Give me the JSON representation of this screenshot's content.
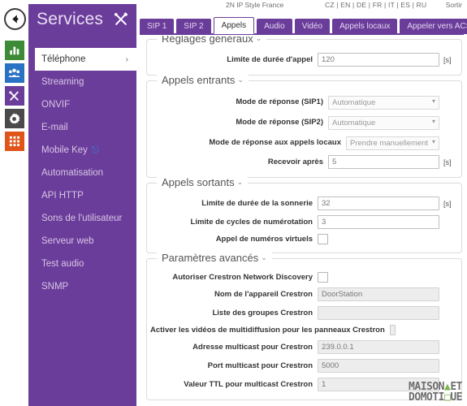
{
  "topbar": {
    "device_name": "2N IP Style France",
    "languages": [
      "CZ",
      "EN",
      "DE",
      "FR",
      "IT",
      "ES",
      "RU"
    ],
    "logout_label": "Sortir"
  },
  "header": {
    "title": "Services",
    "tools_icon": "tools-icon",
    "back_icon": "back-arrow-icon"
  },
  "icon_rail": [
    {
      "name": "status-dashboard-icon",
      "glyph": "bar-chart-icon",
      "color": "#3d8b37"
    },
    {
      "name": "directory-icon",
      "glyph": "people-icon",
      "color": "#2a72c4"
    },
    {
      "name": "services-icon",
      "glyph": "tools-icon",
      "color": "#6b3d9a"
    },
    {
      "name": "hardware-icon",
      "glyph": "gear-icon",
      "color": "#4a4a4a"
    },
    {
      "name": "system-icon",
      "glyph": "grid-icon",
      "color": "#e0541a"
    }
  ],
  "sidebar": {
    "items": [
      {
        "label": "Téléphone",
        "active": true,
        "chevron": "›"
      },
      {
        "label": "Streaming",
        "active": false
      },
      {
        "label": "ONVIF",
        "active": false
      },
      {
        "label": "E-mail",
        "active": false
      },
      {
        "label": "Mobile Key",
        "active": false,
        "badge_icon": "bluetooth-icon"
      },
      {
        "label": "Automatisation",
        "active": false
      },
      {
        "label": "API HTTP",
        "active": false
      },
      {
        "label": "Sons de l'utilisateur",
        "active": false
      },
      {
        "label": "Serveur web",
        "active": false
      },
      {
        "label": "Test audio",
        "active": false
      },
      {
        "label": "SNMP",
        "active": false
      }
    ]
  },
  "tabs": [
    {
      "label": "SIP 1",
      "active": false
    },
    {
      "label": "SIP 2",
      "active": false
    },
    {
      "label": "Appels",
      "active": true
    },
    {
      "label": "Audio",
      "active": false
    },
    {
      "label": "Vidéo",
      "active": false
    },
    {
      "label": "Appels locaux",
      "active": false
    },
    {
      "label": "Appeler vers ACS",
      "active": false
    }
  ],
  "sections": {
    "general": {
      "title": "Réglages généraux",
      "caret": "⌄",
      "call_duration_limit": {
        "label": "Limite de durée d'appel",
        "value": "120",
        "unit": "[s]"
      }
    },
    "incoming": {
      "title": "Appels entrants",
      "caret": "⌄",
      "answer_mode_sip1": {
        "label": "Mode de réponse (SIP1)",
        "value": "Automatique",
        "options": [
          "Automatique",
          "Prendre manuellement"
        ]
      },
      "answer_mode_sip2": {
        "label": "Mode de réponse (SIP2)",
        "value": "Automatique",
        "options": [
          "Automatique",
          "Prendre manuellement"
        ]
      },
      "answer_mode_local": {
        "label": "Mode de réponse aux appels locaux",
        "value": "Prendre manuellement",
        "options": [
          "Automatique",
          "Prendre manuellement"
        ]
      },
      "receive_after": {
        "label": "Recevoir après",
        "value": "5",
        "unit": "[s]"
      }
    },
    "outgoing": {
      "title": "Appels sortants",
      "caret": "⌄",
      "ring_duration_limit": {
        "label": "Limite de durée de la sonnerie",
        "value": "32",
        "unit": "[s]"
      },
      "dial_cycles_limit": {
        "label": "Limite de cycles de numérotation",
        "value": "3",
        "unit": ""
      },
      "virtual_numbers_call": {
        "label": "Appel de numéros virtuels",
        "checked": false
      }
    },
    "advanced": {
      "title": "Paramètres avancés",
      "caret": "⌄",
      "crestron_discovery": {
        "label": "Autoriser Crestron Network Discovery",
        "checked": false
      },
      "crestron_device_name": {
        "label": "Nom de l'appareil Crestron",
        "value": "DoorStation"
      },
      "crestron_group_list": {
        "label": "Liste des groupes Crestron",
        "value": ""
      },
      "crestron_multicast_video": {
        "label": "Activer les vidéos de multidiffusion pour les panneaux Crestron",
        "checked": false
      },
      "crestron_multicast_address": {
        "label": "Adresse multicast pour Crestron",
        "value": "239.0.0.1"
      },
      "crestron_multicast_port": {
        "label": "Port multicast pour Crestron",
        "value": "5000"
      },
      "crestron_multicast_ttl": {
        "label": "Valeur TTL pour multicast Crestron",
        "value": "1"
      }
    }
  },
  "watermark": {
    "line1_a": "MAISON",
    "line1_b": "ET",
    "line2_a": "DOMOTI",
    "line2_b": "UE"
  }
}
